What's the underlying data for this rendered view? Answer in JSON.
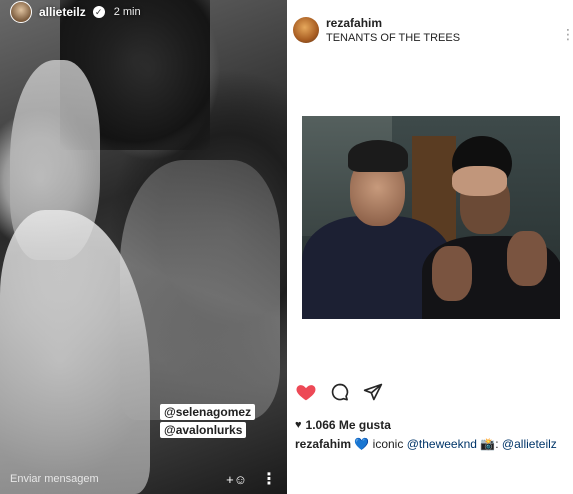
{
  "story": {
    "username": "allieteilz",
    "time": "2 min",
    "mentions": [
      "@selenagomez",
      "@avalonlurks"
    ],
    "footer_placeholder": "Enviar mensagem",
    "add_person_icon": "+person-icon",
    "more_icon": "vertical-dots-icon"
  },
  "post": {
    "username": "rezafahim",
    "location": "TENANTS OF THE TREES",
    "likes": "1.066 Me gusta",
    "caption": {
      "user": "rezafahim",
      "emoji1": "💙",
      "text1": "iconic",
      "tag1": "@theweeknd",
      "emoji2": "📸",
      "text2": ":",
      "tag2": "@allieteilz"
    },
    "colors": {
      "like_heart": "#ed4956",
      "blue_heart": "#5ab4e6",
      "tag": "#003569"
    }
  }
}
